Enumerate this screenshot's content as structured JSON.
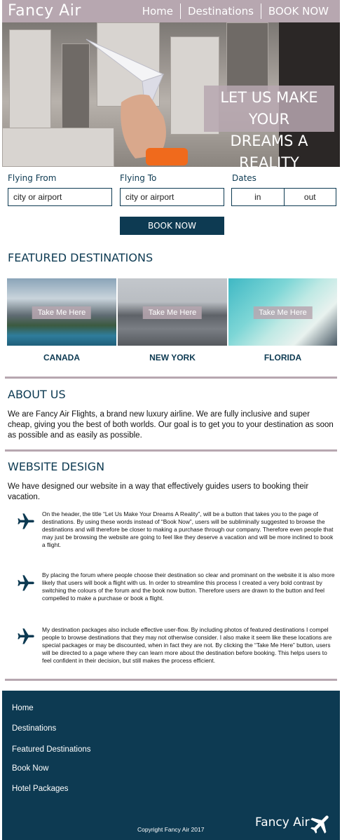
{
  "header": {
    "logo": "Fancy Air",
    "nav": [
      "Home",
      "Destinations",
      "BOOK NOW"
    ]
  },
  "hero": {
    "tagline_line1": "LET US MAKE YOUR",
    "tagline_line2": "DREAMS A REALITY"
  },
  "booking": {
    "flying_from_label": "Flying From",
    "flying_from_placeholder": "city or airport",
    "flying_to_label": "Flying To",
    "flying_to_placeholder": "city or airport",
    "dates_label": "Dates",
    "date_in": "in",
    "date_out": "out",
    "book_button": "BOOK NOW"
  },
  "featured": {
    "title": "FEATURED DESTINATIONS",
    "button_label": "Take Me Here",
    "items": [
      "CANADA",
      "NEW YORK",
      "FLORIDA"
    ]
  },
  "about": {
    "title": "ABOUT US",
    "text": "We are Fancy Air Flights, a brand new luxury airline. We are fully inclusive and super cheap, giving you the best of both worlds. Our goal is to get you to your destination as soon as possible and as easily as possible."
  },
  "design": {
    "title": "WEBSITE DESIGN",
    "intro": "We have designed our website in a way that effectively guides users to booking their vacation.",
    "points": [
      "On the header, the title “Let Us Make Your Dreams A Reality”, will be a button that takes you to the page of destinations. By using these words instead of “Book Now”, users will be subliminally suggested to browse the destinations and will therefore be closer to making a purchase through our company. Therefore even people that may just be browsing the website are going to feel like they deserve a vacation and will be more inclined to book a flight.",
      "By placing the forum where people choose their destination so clear and prominant on the website it is also more likely that users will book a flight with us. In order to streamline this process I created a very bold contrast by switching the colours of the forum and the book now button. Therefore users are drawn to the button and feel compelled to make a purchase or book a flight.",
      "My destination packages also include effective user-flow. By including photos of featured destinations I compel people to browse destinations that they may not otherwise consider. I also make it seem like these locations are special packages or may be discounted, when in fact they are not. By clicking the “Take Me Here” button, users will be directed to a page where they can learn more about the destination before booking. This helps users to feel confident in their decision, but still makes the process efficient."
    ]
  },
  "footer": {
    "links": [
      "Home",
      "Destinations",
      "Featured Destinations",
      "Book Now",
      "Hotel Packages"
    ],
    "copyright": "Copyright Fancy Air 2017",
    "logo": "Fancy Air"
  },
  "colors": {
    "accent": "#b7a7b0",
    "primary": "#0d3a52"
  }
}
